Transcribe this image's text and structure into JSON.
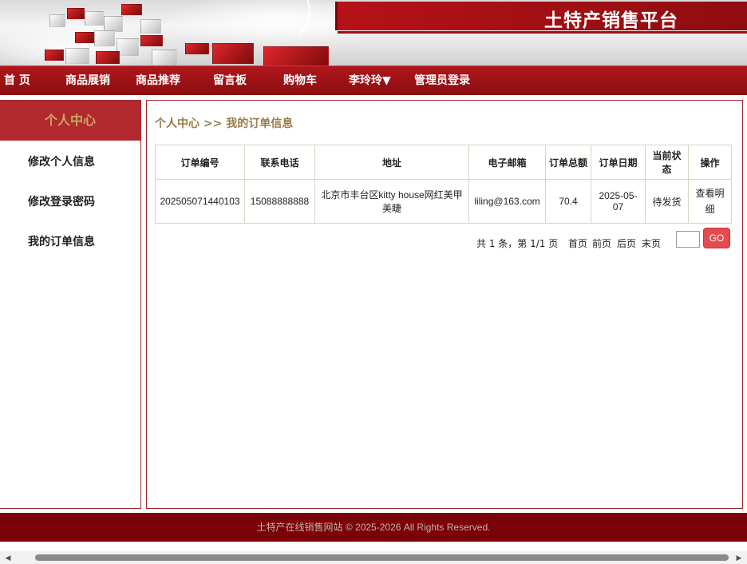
{
  "site": {
    "title": "土特产销售平台"
  },
  "nav": {
    "items": [
      {
        "label": "首 页"
      },
      {
        "label": "商品展销"
      },
      {
        "label": "商品推荐"
      },
      {
        "label": "留言板"
      },
      {
        "label": "购物车"
      },
      {
        "label": "李玲玲▼"
      },
      {
        "label": "管理员登录"
      }
    ]
  },
  "sidebar": {
    "title": "个人中心",
    "items": [
      {
        "label": "修改个人信息"
      },
      {
        "label": "修改登录密码"
      },
      {
        "label": "我的订单信息"
      }
    ]
  },
  "main": {
    "breadcrumb": "个人中心 >> 我的订单信息",
    "table": {
      "headers": [
        "订单编号",
        "联系电话",
        "地址",
        "电子邮箱",
        "订单总额",
        "订单日期",
        "当前状态",
        "操作"
      ],
      "rows": [
        {
          "order_no": "202505071440103",
          "phone": "15088888888",
          "address": "北京市丰台区kitty house网红美甲美睫",
          "email": "liling@163.com",
          "total": "70.4",
          "date": "2025-05-07",
          "status": "待发货",
          "action": "查看明细"
        }
      ]
    },
    "pager": {
      "summary": "共 1 条，第 1/1 页",
      "first": "首页",
      "prev": "前页",
      "next": "后页",
      "last": "末页",
      "page_value": "",
      "go_label": "GO"
    }
  },
  "footer": {
    "text": "土特产在线销售网站 © 2025-2026 All Rights Reserved."
  },
  "colors": {
    "brand_red": "#8f0c10",
    "nav_red": "#a01317",
    "footer_red": "#7a0307",
    "sidebar_head": "#b22a2d",
    "accent_gold": "#9a7a4a",
    "go_button": "#e54a4f"
  }
}
